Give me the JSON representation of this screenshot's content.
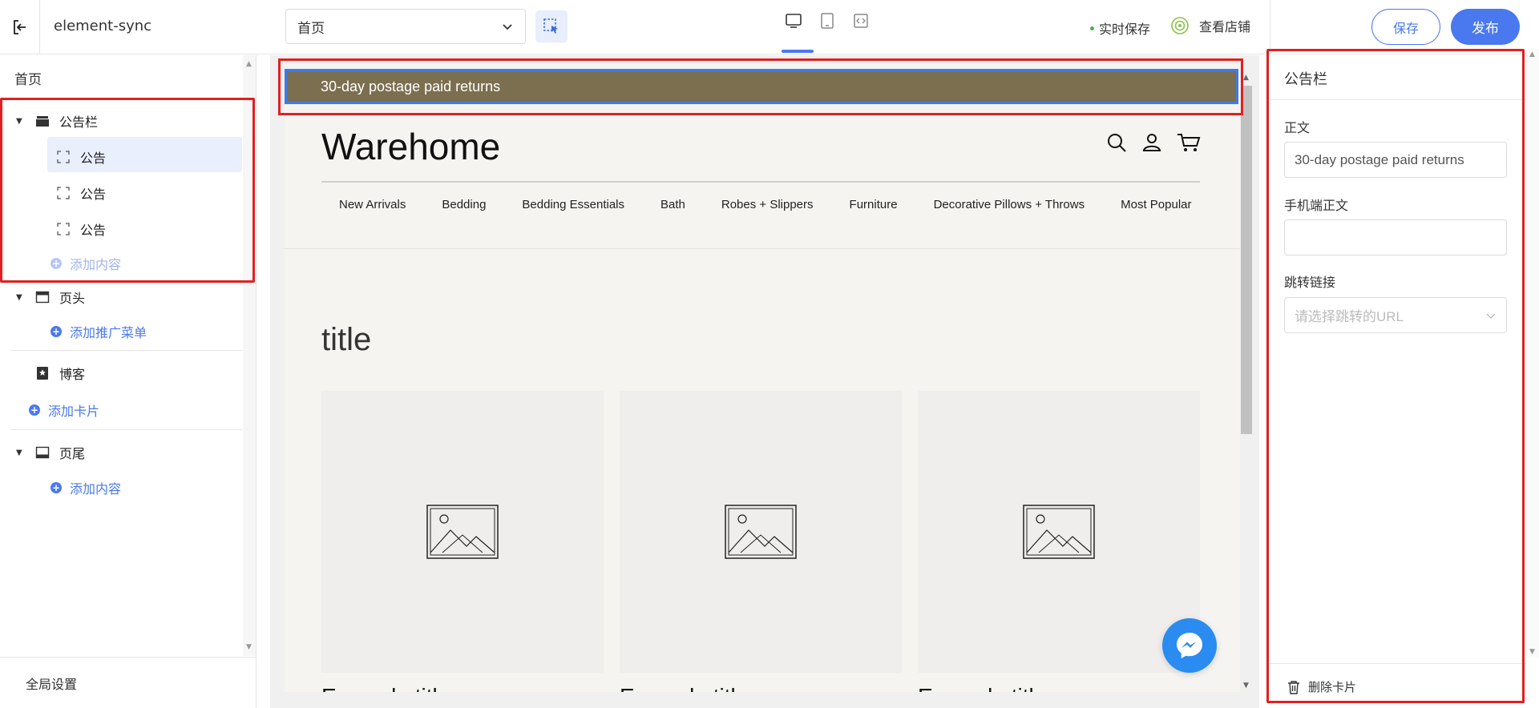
{
  "topbar": {
    "app_name": "element-sync",
    "page_select": "首页",
    "autosave": "实时保存",
    "view_store": "查看店铺",
    "save_label": "保存",
    "publish_label": "发布"
  },
  "sidebar": {
    "title": "首页",
    "sections": {
      "announcement": {
        "label": "公告栏",
        "children": [
          "公告",
          "公告",
          "公告"
        ],
        "add_label": "添加内容"
      },
      "header": {
        "label": "页头",
        "add_label": "添加推广菜单"
      },
      "blog": {
        "label": "博客"
      },
      "add_card": "添加卡片",
      "footer": {
        "label": "页尾",
        "add_label": "添加内容"
      }
    },
    "global_settings": "全局设置"
  },
  "preview": {
    "announcement_text": "30-day postage paid returns",
    "brand": "Warehome",
    "nav": [
      "New Arrivals",
      "Bedding",
      "Bedding Essentials",
      "Bath",
      "Robes + Slippers",
      "Furniture",
      "Decorative Pillows + Throws",
      "Most Popular"
    ],
    "section_title": "title",
    "cards": [
      {
        "title": "Example title"
      },
      {
        "title": "Example title"
      },
      {
        "title": "Example title"
      }
    ]
  },
  "rpanel": {
    "title": "公告栏",
    "body_label": "正文",
    "body_value": "30-day postage paid returns",
    "mobile_label": "手机端正文",
    "mobile_value": "",
    "link_label": "跳转链接",
    "link_placeholder": "请选择跳转的URL",
    "delete_label": "删除卡片"
  },
  "colors": {
    "accent": "#4a78ef",
    "announcement_bg": "#7c6f50",
    "highlight": "#e02020",
    "messenger": "#2a8cf0"
  }
}
